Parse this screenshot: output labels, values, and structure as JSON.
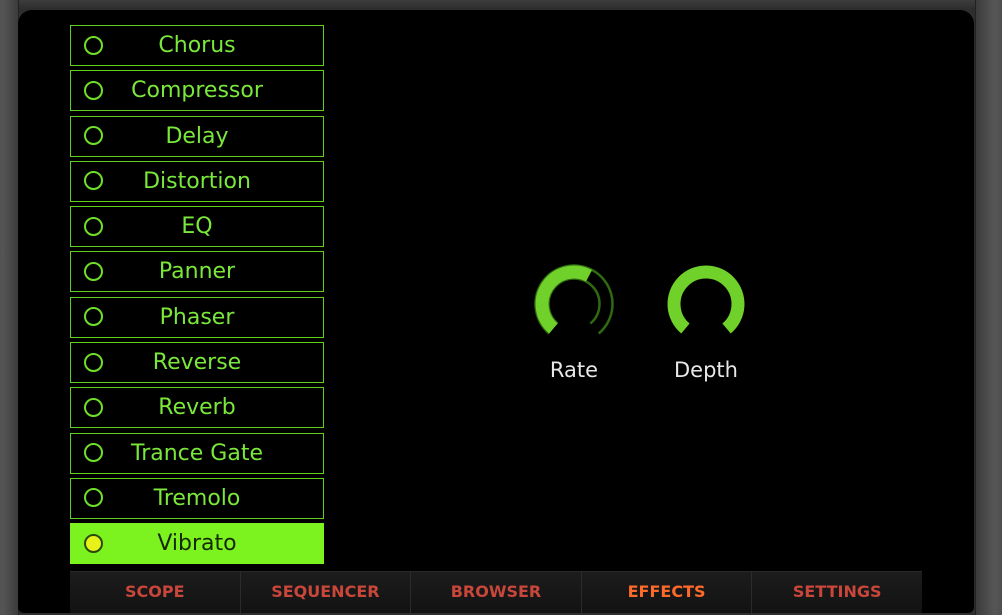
{
  "effects": {
    "items": [
      {
        "label": "Chorus",
        "active": false
      },
      {
        "label": "Compressor",
        "active": false
      },
      {
        "label": "Delay",
        "active": false
      },
      {
        "label": "Distortion",
        "active": false
      },
      {
        "label": "EQ",
        "active": false
      },
      {
        "label": "Panner",
        "active": false
      },
      {
        "label": "Phaser",
        "active": false
      },
      {
        "label": "Reverse",
        "active": false
      },
      {
        "label": "Reverb",
        "active": false
      },
      {
        "label": "Trance Gate",
        "active": false
      },
      {
        "label": "Tremolo",
        "active": false
      },
      {
        "label": "Vibrato",
        "active": true
      }
    ]
  },
  "knobs": {
    "rate": {
      "label": "Rate",
      "value": 0.6
    },
    "depth": {
      "label": "Depth",
      "value": 1.0
    }
  },
  "tabs": [
    {
      "label": "SCOPE",
      "active": false
    },
    {
      "label": "SEQUENCER",
      "active": false
    },
    {
      "label": "BROWSER",
      "active": false
    },
    {
      "label": "EFFECTS",
      "active": true
    },
    {
      "label": "SETTINGS",
      "active": false
    }
  ],
  "colors": {
    "accent": "#7cf21f",
    "active_led": "#e6f21a",
    "tab_text": "#c9463a",
    "tab_active": "#ff6a2a"
  }
}
